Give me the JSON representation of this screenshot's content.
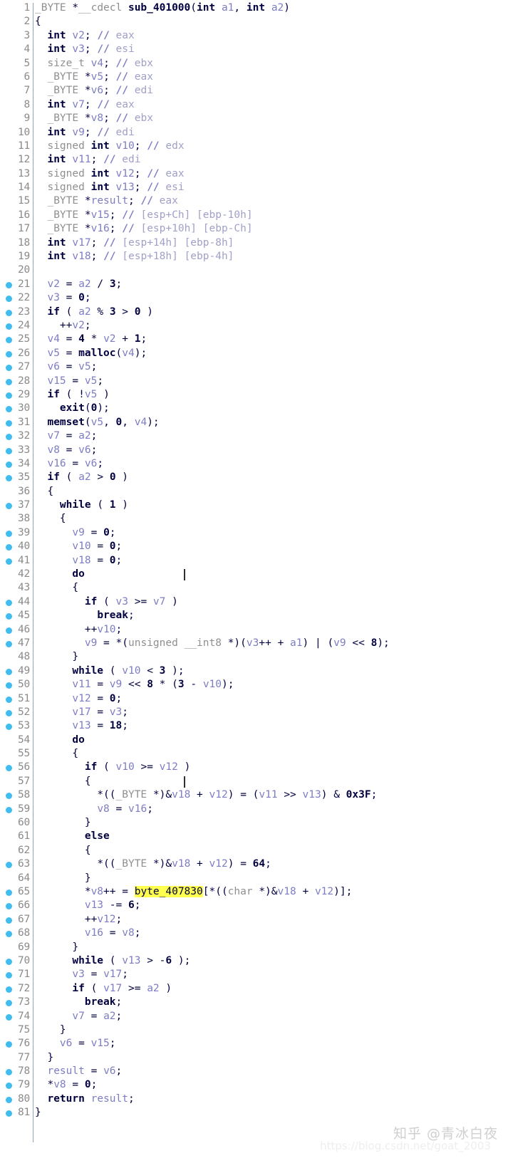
{
  "view": {
    "name": "Hex-Rays Pseudocode",
    "function_signature": "_BYTE *__cdecl sub_401000(int a1, int a2)",
    "highlighted_identifier": "byte_407830",
    "highlight_color": "#ffff4d",
    "breakpoint_dot_color": "#3fbdf0",
    "background_color": "#ffffff",
    "line_number_color": "#8a8a8a",
    "first_line": 1,
    "last_line": 81
  },
  "watermarks": {
    "zhihu": "知乎 @青冰白夜",
    "csdn": "https://blog.csdn.net/goat_2003"
  },
  "lines": [
    {
      "n": "1",
      "dot": false,
      "code": "_BYTE *__cdecl sub_401000(int a1, int a2)"
    },
    {
      "n": "2",
      "dot": false,
      "code": "{"
    },
    {
      "n": "3",
      "dot": false,
      "code": "  int v2; // eax"
    },
    {
      "n": "4",
      "dot": false,
      "code": "  int v3; // esi"
    },
    {
      "n": "5",
      "dot": false,
      "code": "  size_t v4; // ebx"
    },
    {
      "n": "6",
      "dot": false,
      "code": "  _BYTE *v5; // eax"
    },
    {
      "n": "7",
      "dot": false,
      "code": "  _BYTE *v6; // edi"
    },
    {
      "n": "8",
      "dot": false,
      "code": "  int v7; // eax"
    },
    {
      "n": "9",
      "dot": false,
      "code": "  _BYTE *v8; // ebx"
    },
    {
      "n": "10",
      "dot": false,
      "code": "  int v9; // edi"
    },
    {
      "n": "11",
      "dot": false,
      "code": "  signed int v10; // edx"
    },
    {
      "n": "12",
      "dot": false,
      "code": "  int v11; // edi"
    },
    {
      "n": "13",
      "dot": false,
      "code": "  signed int v12; // eax"
    },
    {
      "n": "14",
      "dot": false,
      "code": "  signed int v13; // esi"
    },
    {
      "n": "15",
      "dot": false,
      "code": "  _BYTE *result; // eax"
    },
    {
      "n": "16",
      "dot": false,
      "code": "  _BYTE *v15; // [esp+Ch] [ebp-10h]"
    },
    {
      "n": "17",
      "dot": false,
      "code": "  _BYTE *v16; // [esp+10h] [ebp-Ch]"
    },
    {
      "n": "18",
      "dot": false,
      "code": "  int v17; // [esp+14h] [ebp-8h]"
    },
    {
      "n": "19",
      "dot": false,
      "code": "  int v18; // [esp+18h] [ebp-4h]"
    },
    {
      "n": "20",
      "dot": false,
      "code": ""
    },
    {
      "n": "21",
      "dot": true,
      "code": "  v2 = a2 / 3;"
    },
    {
      "n": "22",
      "dot": true,
      "code": "  v3 = 0;"
    },
    {
      "n": "23",
      "dot": true,
      "code": "  if ( a2 % 3 > 0 )"
    },
    {
      "n": "24",
      "dot": true,
      "code": "    ++v2;"
    },
    {
      "n": "25",
      "dot": true,
      "code": "  v4 = 4 * v2 + 1;"
    },
    {
      "n": "26",
      "dot": true,
      "code": "  v5 = malloc(v4);"
    },
    {
      "n": "27",
      "dot": true,
      "code": "  v6 = v5;"
    },
    {
      "n": "28",
      "dot": true,
      "code": "  v15 = v5;"
    },
    {
      "n": "29",
      "dot": true,
      "code": "  if ( !v5 )"
    },
    {
      "n": "30",
      "dot": true,
      "code": "    exit(0);"
    },
    {
      "n": "31",
      "dot": true,
      "code": "  memset(v5, 0, v4);"
    },
    {
      "n": "32",
      "dot": true,
      "code": "  v7 = a2;"
    },
    {
      "n": "33",
      "dot": true,
      "code": "  v8 = v6;"
    },
    {
      "n": "34",
      "dot": true,
      "code": "  v16 = v6;"
    },
    {
      "n": "35",
      "dot": true,
      "code": "  if ( a2 > 0 )"
    },
    {
      "n": "36",
      "dot": false,
      "code": "  {"
    },
    {
      "n": "37",
      "dot": true,
      "code": "    while ( 1 )"
    },
    {
      "n": "38",
      "dot": false,
      "code": "    {"
    },
    {
      "n": "39",
      "dot": true,
      "code": "      v9 = 0;"
    },
    {
      "n": "40",
      "dot": true,
      "code": "      v10 = 0;"
    },
    {
      "n": "41",
      "dot": true,
      "code": "      v18 = 0;"
    },
    {
      "n": "42",
      "dot": false,
      "code": "      do"
    },
    {
      "n": "43",
      "dot": false,
      "code": "      {"
    },
    {
      "n": "44",
      "dot": true,
      "code": "        if ( v3 >= v7 )"
    },
    {
      "n": "45",
      "dot": true,
      "code": "          break;"
    },
    {
      "n": "46",
      "dot": true,
      "code": "        ++v10;"
    },
    {
      "n": "47",
      "dot": true,
      "code": "        v9 = *(unsigned __int8 *)(v3++ + a1) | (v9 << 8);"
    },
    {
      "n": "48",
      "dot": false,
      "code": "      }"
    },
    {
      "n": "49",
      "dot": true,
      "code": "      while ( v10 < 3 );"
    },
    {
      "n": "50",
      "dot": true,
      "code": "      v11 = v9 << 8 * (3 - v10);"
    },
    {
      "n": "51",
      "dot": true,
      "code": "      v12 = 0;"
    },
    {
      "n": "52",
      "dot": true,
      "code": "      v17 = v3;"
    },
    {
      "n": "53",
      "dot": true,
      "code": "      v13 = 18;"
    },
    {
      "n": "54",
      "dot": false,
      "code": "      do"
    },
    {
      "n": "55",
      "dot": false,
      "code": "      {"
    },
    {
      "n": "56",
      "dot": true,
      "code": "        if ( v10 >= v12 )"
    },
    {
      "n": "57",
      "dot": false,
      "code": "        {"
    },
    {
      "n": "58",
      "dot": true,
      "code": "          *((_BYTE *)&v18 + v12) = (v11 >> v13) & 0x3F;"
    },
    {
      "n": "59",
      "dot": true,
      "code": "          v8 = v16;"
    },
    {
      "n": "60",
      "dot": false,
      "code": "        }"
    },
    {
      "n": "61",
      "dot": false,
      "code": "        else"
    },
    {
      "n": "62",
      "dot": false,
      "code": "        {"
    },
    {
      "n": "63",
      "dot": true,
      "code": "          *((_BYTE *)&v18 + v12) = 64;"
    },
    {
      "n": "64",
      "dot": false,
      "code": "        }"
    },
    {
      "n": "65",
      "dot": true,
      "code": "        *v8++ = byte_407830[*((char *)&v18 + v12)];"
    },
    {
      "n": "66",
      "dot": true,
      "code": "        v13 -= 6;"
    },
    {
      "n": "67",
      "dot": true,
      "code": "        ++v12;"
    },
    {
      "n": "68",
      "dot": true,
      "code": "        v16 = v8;"
    },
    {
      "n": "69",
      "dot": false,
      "code": "      }"
    },
    {
      "n": "70",
      "dot": true,
      "code": "      while ( v13 > -6 );"
    },
    {
      "n": "71",
      "dot": true,
      "code": "      v3 = v17;"
    },
    {
      "n": "72",
      "dot": true,
      "code": "      if ( v17 >= a2 )"
    },
    {
      "n": "73",
      "dot": true,
      "code": "        break;"
    },
    {
      "n": "74",
      "dot": true,
      "code": "      v7 = a2;"
    },
    {
      "n": "75",
      "dot": false,
      "code": "    }"
    },
    {
      "n": "76",
      "dot": true,
      "code": "    v6 = v15;"
    },
    {
      "n": "77",
      "dot": false,
      "code": "  }"
    },
    {
      "n": "78",
      "dot": true,
      "code": "  result = v6;"
    },
    {
      "n": "79",
      "dot": true,
      "code": "  *v8 = 0;"
    },
    {
      "n": "80",
      "dot": true,
      "code": "  return result;"
    },
    {
      "n": "81",
      "dot": true,
      "code": "}"
    }
  ],
  "carets": [
    {
      "line": 42,
      "col": 24
    },
    {
      "line": 57,
      "col": 24
    }
  ]
}
